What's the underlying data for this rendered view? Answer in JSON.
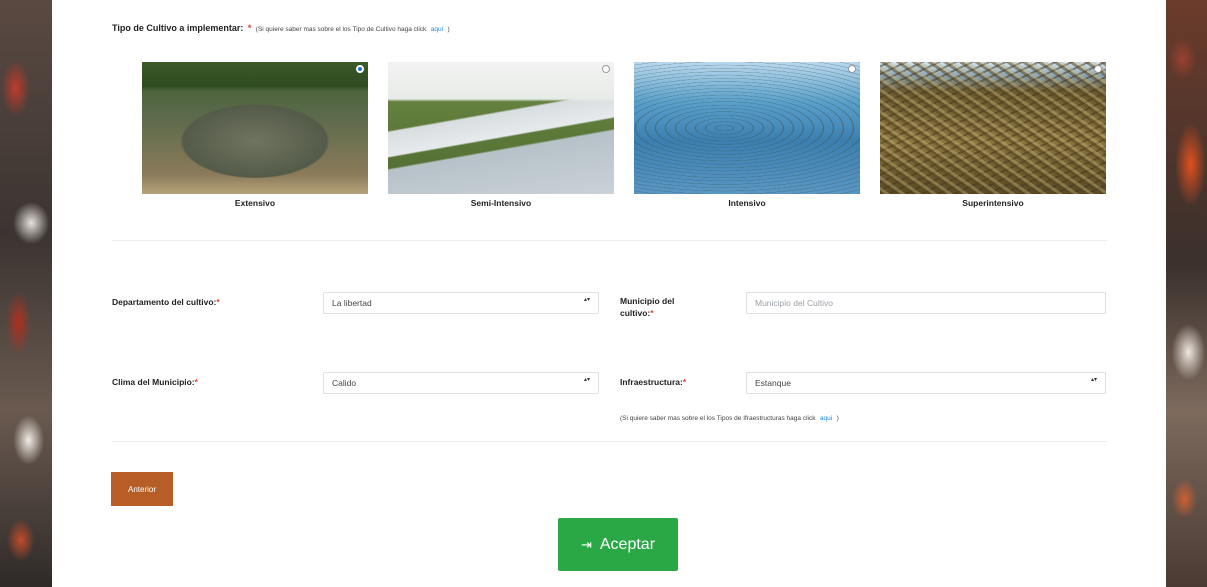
{
  "crop_type": {
    "label": "Tipo de Cultivo a implementar:",
    "required_mark": "*",
    "help_prefix": "(Si quiere saber mas sobre el los Tipo de Cultivo haga click",
    "help_link": "aqui",
    "help_suffix": ")"
  },
  "options": [
    {
      "label": "Extensivo",
      "selected": true
    },
    {
      "label": "Semi-Intensivo",
      "selected": false
    },
    {
      "label": "Intensivo",
      "selected": false
    },
    {
      "label": "Superintensivo",
      "selected": false
    }
  ],
  "form": {
    "department": {
      "label": "Departamento del cultivo:",
      "required_mark": "*",
      "value": "La libertad"
    },
    "municipality": {
      "label_line1": "Municipio del",
      "label_line2": "cultivo:",
      "required_mark": "*",
      "placeholder": "Municipio del Cultivo"
    },
    "climate": {
      "label": "Clima del Municipio:",
      "required_mark": "*",
      "value": "Calido"
    },
    "infrastructure": {
      "label": "Infraestructura:",
      "required_mark": "*",
      "value": "Estanque",
      "help_prefix": "(Si quiere saber mas sobre el los Tipos de Ifraestructuras haga click",
      "help_link": "aqui",
      "help_suffix": ")"
    },
    "select_caret": "▴▾"
  },
  "buttons": {
    "previous": "Anterior",
    "accept": "Aceptar",
    "accept_icon": "⇥"
  },
  "colors": {
    "accept": "#2aa845",
    "previous": "#b65e26",
    "required": "#e53935",
    "link": "#1e88e5"
  }
}
